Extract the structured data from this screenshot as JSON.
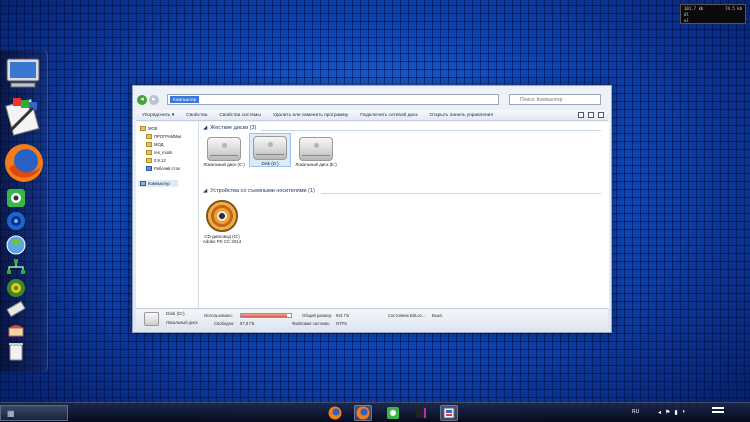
{
  "net_meter": {
    "rows": [
      {
        "left": "101.7 kb",
        "right": "74.5 kb"
      },
      {
        "left": "dl",
        "right": ""
      },
      {
        "left": "ul",
        "right": ""
      }
    ]
  },
  "dock": {
    "items": [
      "computer-icon",
      "notepad-icon",
      "firefox-icon",
      "camera-icon",
      "spiral-icon",
      "globe-icon",
      "network-icon",
      "gear-icon",
      "eraser-icon",
      "cake-icon",
      "trash-icon"
    ]
  },
  "window": {
    "breadcrumb": "Компьютер",
    "search_placeholder": "Поиск: Компьютер",
    "toolbar": {
      "items": [
        "Упорядочить ▾",
        "Свойства",
        "Свойства системы",
        "Удалить или изменить программу",
        "Подключить сетевой диск",
        "Открыть панель управления"
      ]
    },
    "nav": {
      "items": [
        {
          "label": "МОЕ",
          "indent": 0
        },
        {
          "label": "ПРОГРАММЫ",
          "indent": 1
        },
        {
          "label": "МОД",
          "indent": 1
        },
        {
          "label": "res_mods",
          "indent": 1
        },
        {
          "label": "0.9.13",
          "indent": 1
        },
        {
          "label": "Рабочий стол",
          "indent": 1
        },
        {
          "label": "Компьютер",
          "indent": 0
        }
      ]
    },
    "groups": {
      "hdd_header": "Жесткие диски (3)",
      "removable_header": "Устройства со съемными носителями (1)"
    },
    "drives": [
      {
        "name": "Локальный диск (C:)",
        "selected": false
      },
      {
        "name": "Disk (D:)",
        "selected": true
      },
      {
        "name": "Локальный диск (E:)",
        "selected": false
      }
    ],
    "dvd": {
      "name": "CD-дисковод (G:) Adobe PS CC 2014"
    },
    "details": {
      "drive_name": "Disk (D:)",
      "drive_type": "Локальный диск",
      "used_label": "Использовано:",
      "used_fraction": 0.91,
      "free_label": "Свободно:",
      "free_value": "87,8 ГБ",
      "total_label": "Общий размер:",
      "total_value": "931 ГБ",
      "fs_label": "Файловая система:",
      "fs_value": "NTFS",
      "bitlocker_label": "Состояние BitLoc...",
      "bitlocker_value": "Выкл."
    }
  },
  "taskbar": {
    "start_icon": "start-grid-icon",
    "apps": [
      "firefox-icon",
      "firefox-icon",
      "camera-icon",
      "media-icon",
      "explorer-icon"
    ],
    "lang": "RU"
  }
}
